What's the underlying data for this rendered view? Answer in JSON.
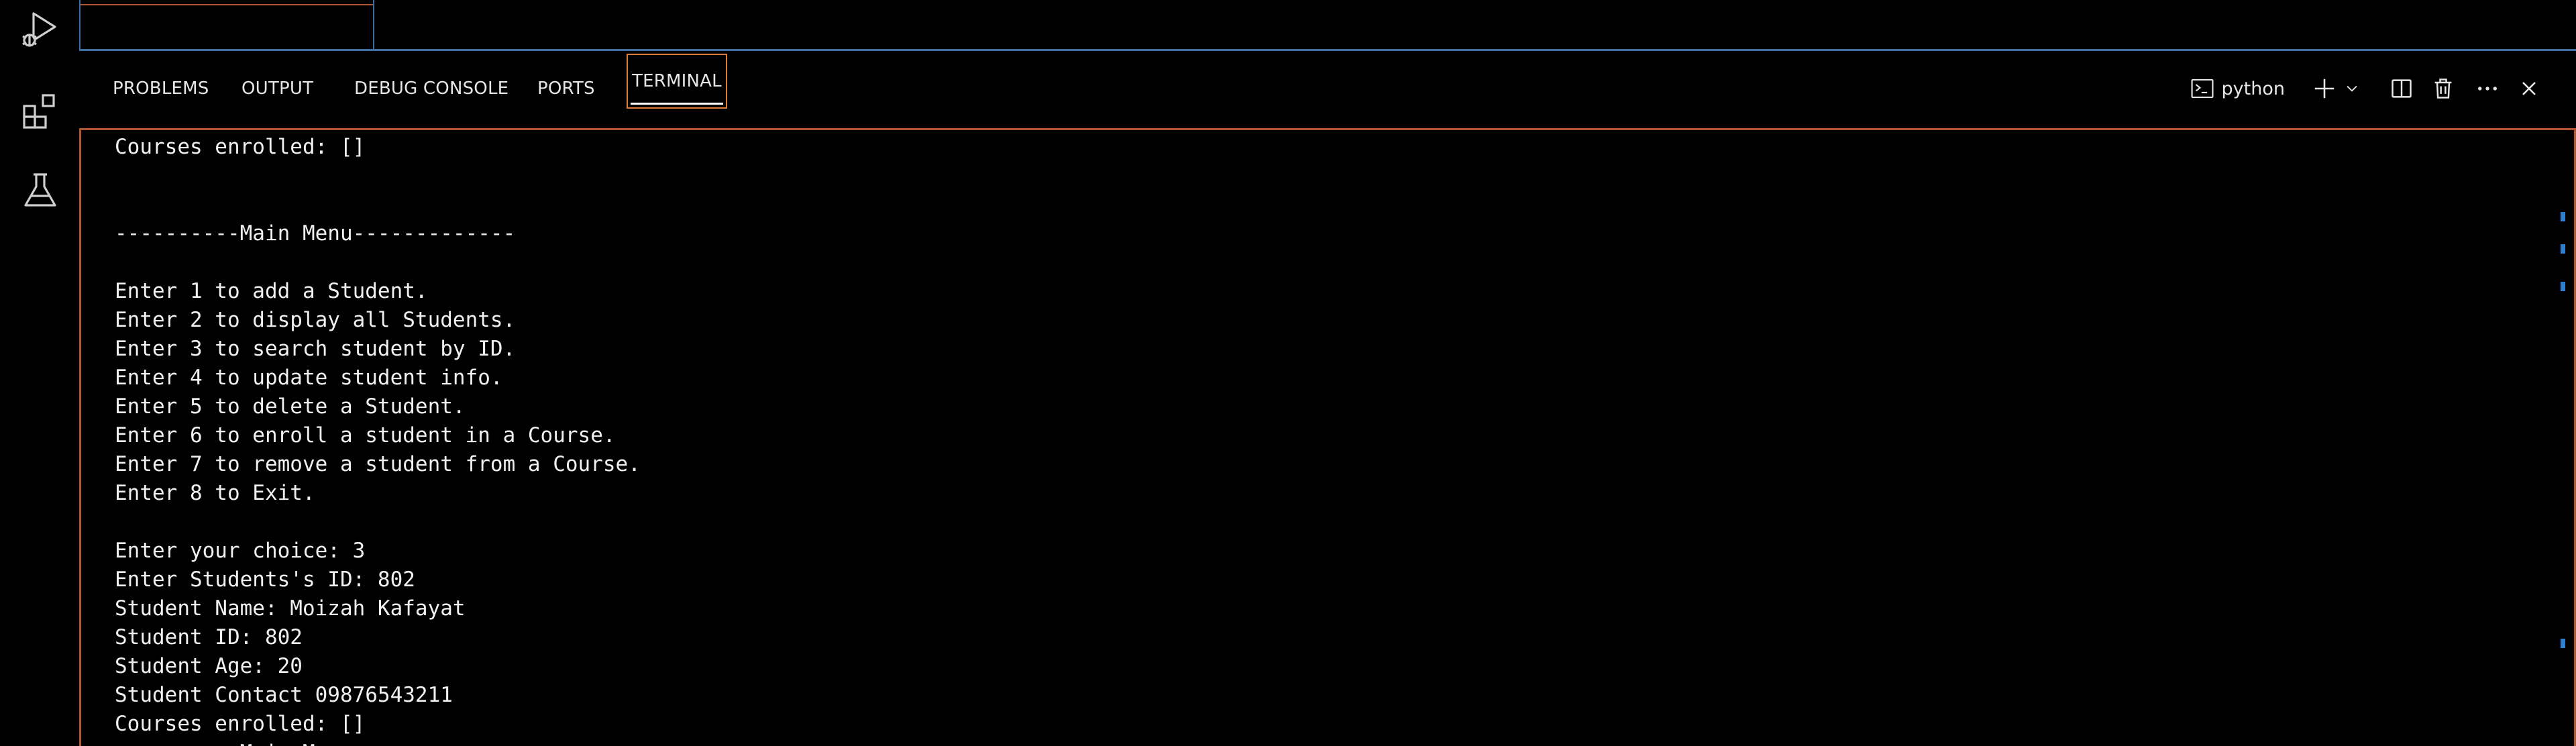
{
  "activity_bar": {
    "items": [
      {
        "name": "run-debug-icon"
      },
      {
        "name": "extensions-icon"
      },
      {
        "name": "testing-icon"
      }
    ]
  },
  "panel": {
    "tabs": [
      {
        "label": "PROBLEMS",
        "active": false
      },
      {
        "label": "OUTPUT",
        "active": false
      },
      {
        "label": "DEBUG CONSOLE",
        "active": false
      },
      {
        "label": "PORTS",
        "active": false
      },
      {
        "label": "TERMINAL",
        "active": true
      }
    ],
    "actions": {
      "terminal_name": "python",
      "icons": [
        "terminal-icon",
        "plus-icon",
        "chevron-down-icon",
        "split-terminal-icon",
        "trash-icon",
        "more-icon",
        "close-icon"
      ]
    }
  },
  "terminal": {
    "lines": [
      "Courses enrolled: []",
      "",
      "",
      "----------Main Menu-------------",
      "",
      "Enter 1 to add a Student.",
      "Enter 2 to display all Students.",
      "Enter 3 to search student by ID.",
      "Enter 4 to update student info.",
      "Enter 5 to delete a Student.",
      "Enter 6 to enroll a student in a Course.",
      "Enter 7 to remove a student from a Course.",
      "Enter 8 to Exit.",
      "",
      "Enter your choice: 3",
      "Enter Students's ID: 802",
      "Student Name: Moizah Kafayat",
      "Student ID: 802",
      "Student Age: 20",
      "Student Contact 09876543211",
      "Courses enrolled: []",
      "----------Main Menu-------------"
    ]
  },
  "colors": {
    "background": "#000000",
    "text": "#f0f0f0",
    "focus_border": "#b0552d",
    "active_tab_border": "#e07b39",
    "editor_border": "#3a6ea5",
    "scroll_marker": "#2d7fd0"
  }
}
